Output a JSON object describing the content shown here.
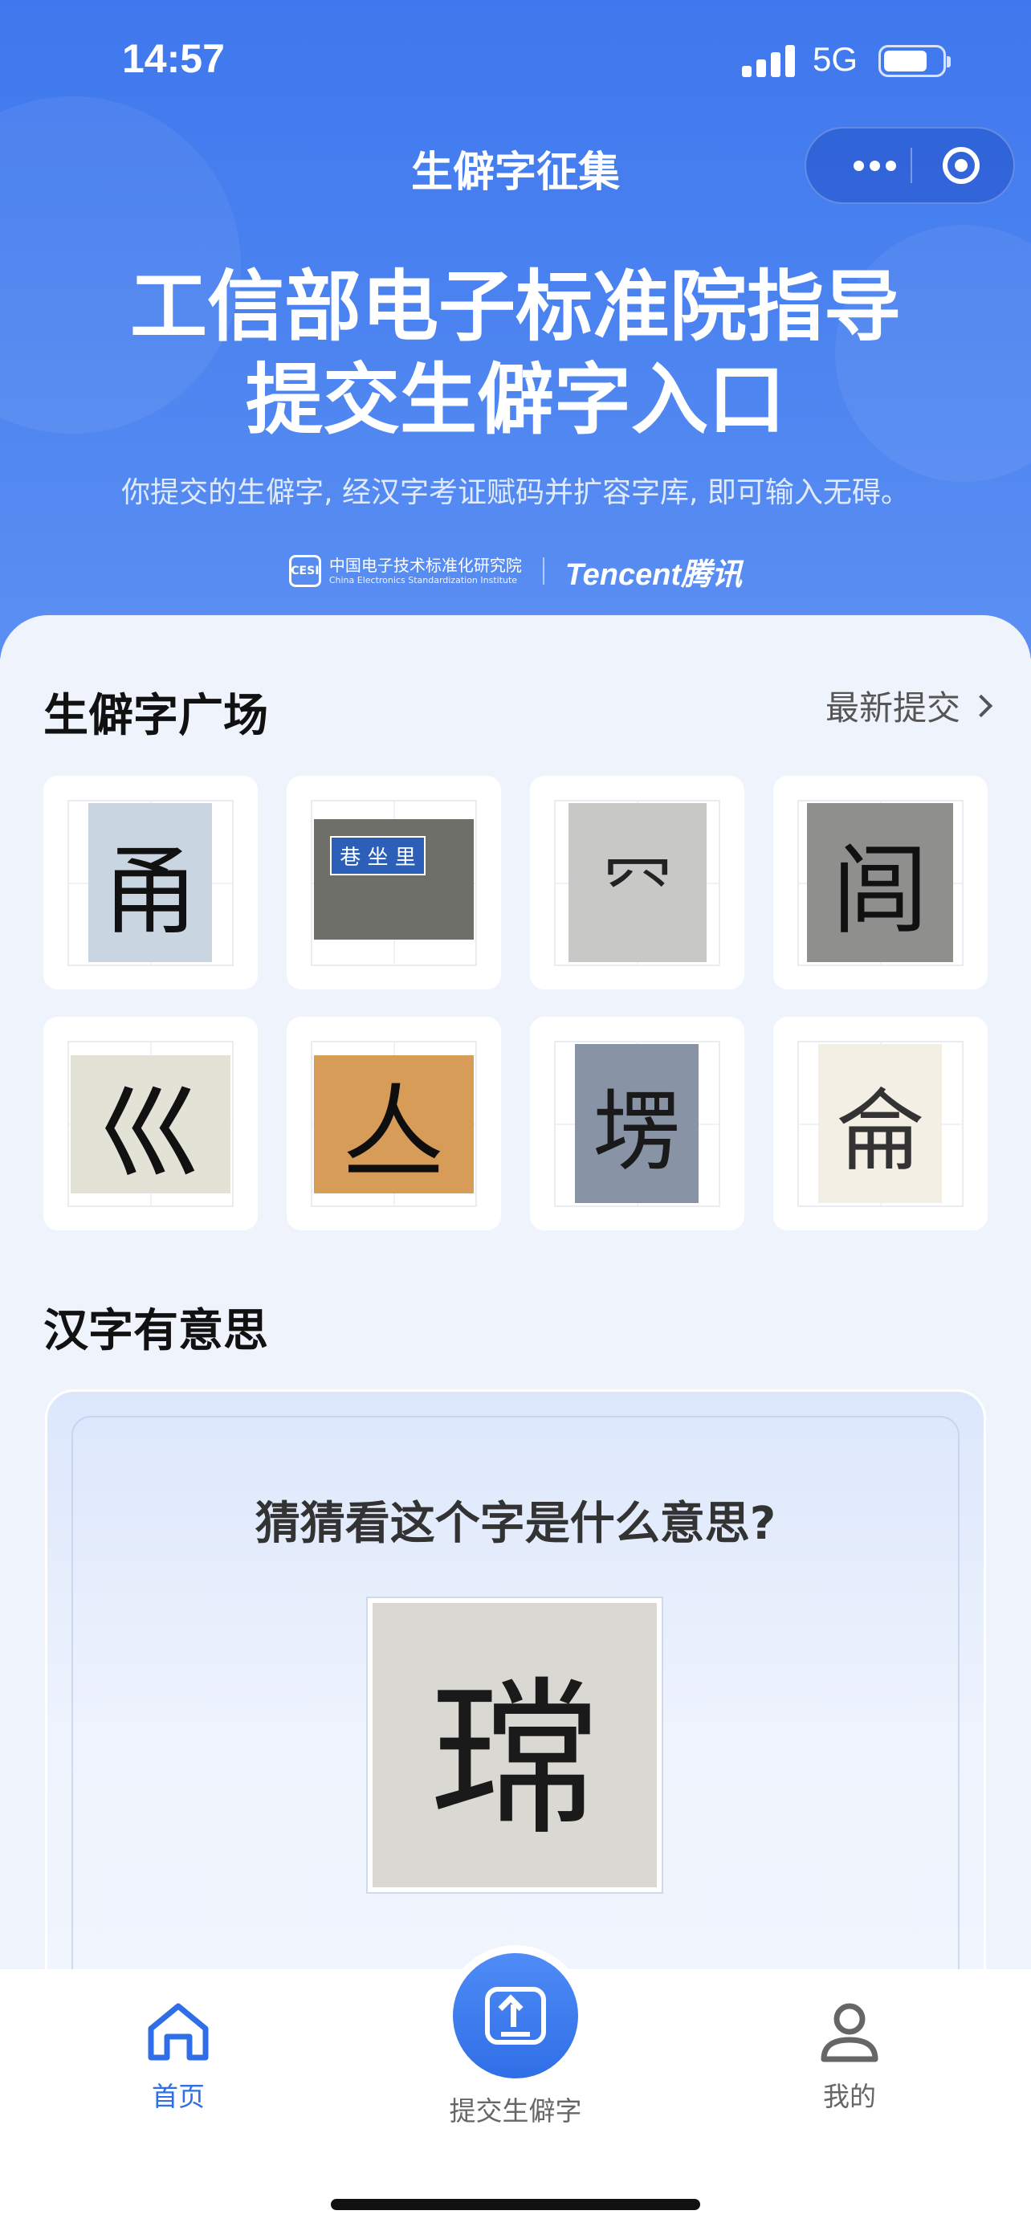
{
  "status_bar": {
    "time": "14:57",
    "network": "5G"
  },
  "nav": {
    "title": "生僻字征集"
  },
  "hero": {
    "title_line1": "工信部电子标准院指导",
    "title_line2": "提交生僻字入口",
    "subtitle": "你提交的生僻字, 经汉字考证赋码并扩容字库, 即可输入无碍。",
    "cesi_cn": "中国电子技术标准化研究院",
    "cesi_en": "China Electronics Standardization Institute",
    "cesi_badge": "CESI",
    "tencent_logo": "Tencent腾讯"
  },
  "square": {
    "title": "生僻字广场",
    "more_label": "最新提交",
    "tiles": [
      {
        "char": "甬",
        "bg": "#c9d6e2",
        "color": "#111"
      },
      {
        "char": "巷 坐 里",
        "bg": "#6f6f6a",
        "color": "#fff"
      },
      {
        "char": "㓁",
        "bg": "#c8c8c6",
        "color": "#222"
      },
      {
        "char": "闾",
        "bg": "#8f8f8d",
        "color": "#111"
      },
      {
        "char": "巛",
        "bg": "#e3e2d6",
        "color": "#111"
      },
      {
        "char": "亼",
        "bg": "#d69c58",
        "color": "#0e0e0e"
      },
      {
        "char": "塄",
        "bg": "#8893a6",
        "color": "#1a1a1a"
      },
      {
        "char": "侖",
        "bg": "#f3efe4",
        "color": "#333"
      }
    ]
  },
  "fun": {
    "title": "汉字有意思",
    "question": "猜猜看这个字是什么意思?",
    "char": "瑺"
  },
  "tabbar": {
    "home": "首页",
    "submit": "提交生僻字",
    "mine": "我的"
  },
  "colors": {
    "brand": "#2f6ee6",
    "hero_top": "#3f78ee"
  }
}
